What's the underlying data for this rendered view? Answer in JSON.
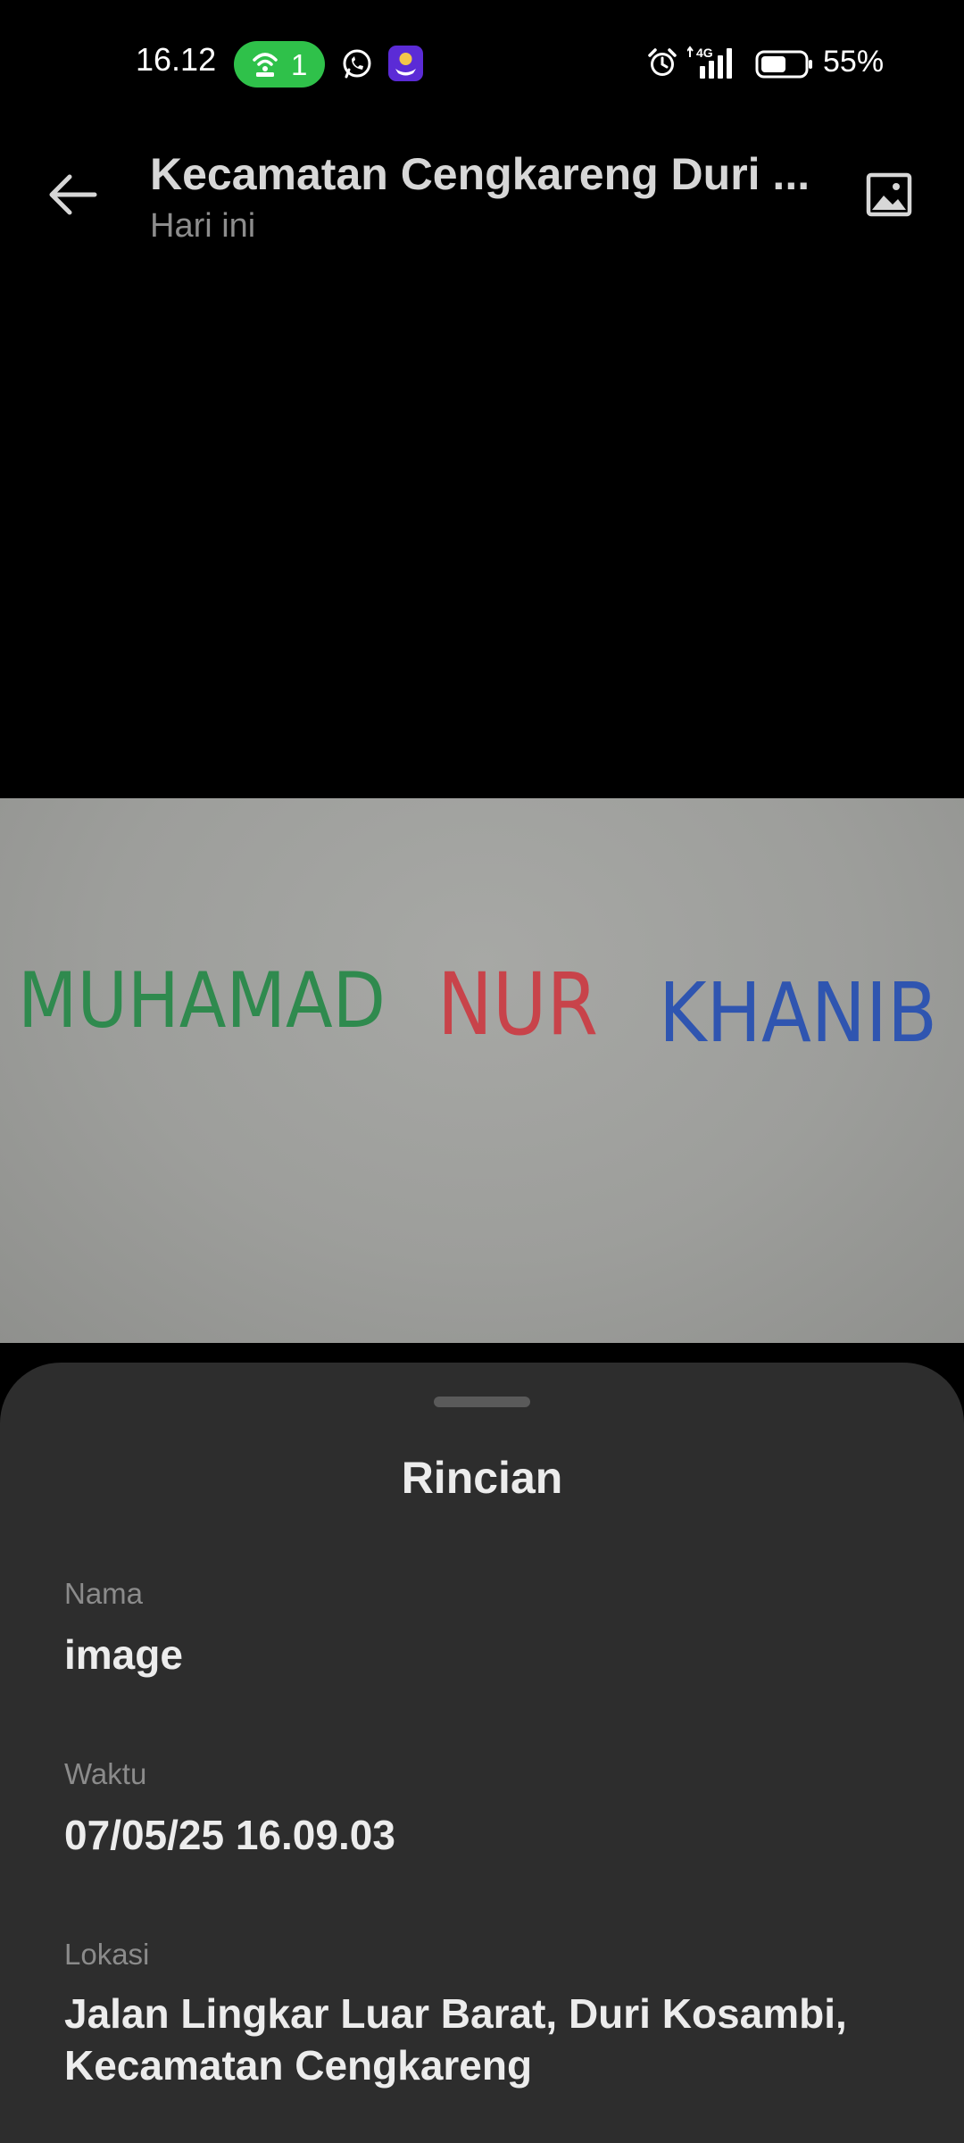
{
  "status_bar": {
    "time": "16.12",
    "hotspot_count": "1",
    "network_type": "4G",
    "battery_percent": "55%",
    "icons": [
      "hotspot-icon",
      "whatsapp-icon",
      "app-icon",
      "alarm-icon",
      "signal-icon",
      "battery-icon"
    ]
  },
  "app_bar": {
    "title": "Kecamatan Cengkareng Duri ...",
    "subtitle": "Hari ini",
    "icons": [
      "back-arrow-icon",
      "gallery-icon"
    ]
  },
  "photo": {
    "words": [
      {
        "text": "MUHAMAD",
        "color": "#2f8a4e"
      },
      {
        "text": "NUR",
        "color": "#c8434a"
      },
      {
        "text": "KHANIB",
        "color": "#2f55b0"
      }
    ]
  },
  "details": {
    "title": "Rincian",
    "name_label": "Nama",
    "name_value": "image",
    "time_label": "Waktu",
    "time_value": "07/05/25 16.09.03",
    "location_label": "Lokasi",
    "location_value": "Jalan Lingkar Luar Barat, Duri Kosambi, Kecamatan Cengkareng"
  }
}
